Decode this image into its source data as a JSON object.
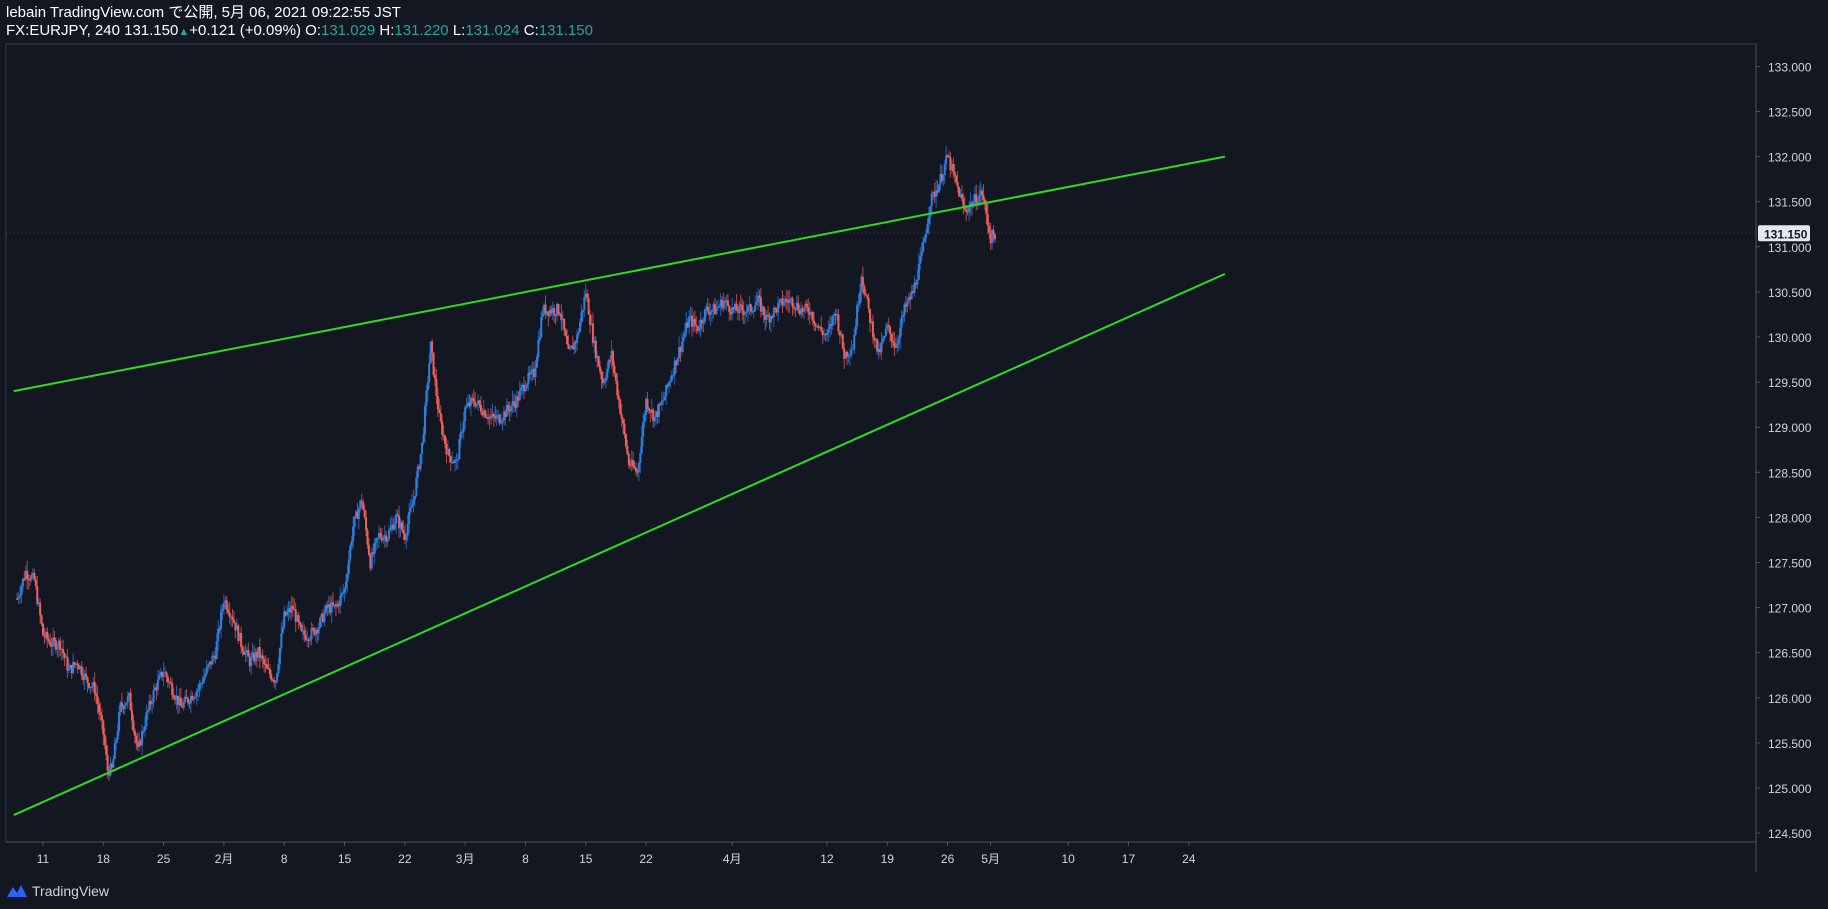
{
  "header": {
    "publisher": "lebain TradingView.com で公開, 5月 06, 2021 09:22:55 JST",
    "symbol_interval": "FX:EURJPY, 240 131.150",
    "change_arrow": "▲",
    "change": "+0.121 (+0.09%)",
    "o_label": "O:",
    "o_value": "131.029",
    "h_label": "H:",
    "h_value": "131.220",
    "l_label": "L:",
    "l_value": "131.024",
    "c_label": "C:",
    "c_value": "131.150"
  },
  "footer": {
    "brand": "TradingView"
  },
  "colors": {
    "background": "#131722",
    "up": "#2f7fe3",
    "down": "#f0605a",
    "trendline": "#2ddc1e",
    "text": "#d1d4dc",
    "price_label_bg": "#e6e8ef"
  },
  "chart_data": {
    "type": "candlestick",
    "symbol": "FX:EURJPY",
    "interval": "240",
    "last_price": 131.15,
    "last_price_label": "131.150",
    "ylim": [
      124.35,
      133.2
    ],
    "y_ticks": [
      "124.500",
      "125.000",
      "125.500",
      "126.000",
      "126.500",
      "127.000",
      "127.500",
      "128.000",
      "128.500",
      "129.000",
      "129.500",
      "130.000",
      "130.500",
      "131.000",
      "131.500",
      "132.000",
      "132.500",
      "133.000"
    ],
    "x_labels": [
      {
        "label": "11",
        "day": 0
      },
      {
        "label": "18",
        "day": 7
      },
      {
        "label": "25",
        "day": 14
      },
      {
        "label": "2月",
        "day": 21
      },
      {
        "label": "8",
        "day": 28
      },
      {
        "label": "15",
        "day": 35
      },
      {
        "label": "22",
        "day": 42
      },
      {
        "label": "3月",
        "day": 49
      },
      {
        "label": "8",
        "day": 56
      },
      {
        "label": "15",
        "day": 63
      },
      {
        "label": "22",
        "day": 70
      },
      {
        "label": "4月",
        "day": 80
      },
      {
        "label": "12",
        "day": 91
      },
      {
        "label": "19",
        "day": 98
      },
      {
        "label": "26",
        "day": 105
      },
      {
        "label": "5月",
        "day": 110
      },
      {
        "label": "10",
        "day": 119
      },
      {
        "label": "17",
        "day": 126
      },
      {
        "label": "24",
        "day": 133
      }
    ],
    "close_path": [
      [
        -3,
        127.1
      ],
      [
        -2,
        127.4
      ],
      [
        -1,
        127.3
      ],
      [
        0,
        126.7
      ],
      [
        1,
        126.6
      ],
      [
        2,
        126.6
      ],
      [
        3,
        126.3
      ],
      [
        4,
        126.4
      ],
      [
        5,
        126.2
      ],
      [
        6,
        126.1
      ],
      [
        7,
        125.6
      ],
      [
        7.5,
        125.2
      ],
      [
        8,
        125.2
      ],
      [
        9,
        125.9
      ],
      [
        10,
        126.0
      ],
      [
        11,
        125.4
      ],
      [
        12,
        125.8
      ],
      [
        13,
        126.1
      ],
      [
        14,
        126.3
      ],
      [
        15,
        126.1
      ],
      [
        16,
        125.9
      ],
      [
        17,
        126.0
      ],
      [
        18,
        126.1
      ],
      [
        19,
        126.3
      ],
      [
        20,
        126.5
      ],
      [
        21,
        127.1
      ],
      [
        22,
        126.9
      ],
      [
        23,
        126.6
      ],
      [
        24,
        126.4
      ],
      [
        25,
        126.5
      ],
      [
        26,
        126.3
      ],
      [
        27,
        126.2
      ],
      [
        28,
        126.9
      ],
      [
        29,
        127.0
      ],
      [
        30,
        126.7
      ],
      [
        31,
        126.7
      ],
      [
        32,
        126.8
      ],
      [
        33,
        127.0
      ],
      [
        34,
        127.0
      ],
      [
        35,
        127.2
      ],
      [
        36,
        127.9
      ],
      [
        37,
        128.2
      ],
      [
        38,
        127.5
      ],
      [
        39,
        127.8
      ],
      [
        40,
        127.8
      ],
      [
        41,
        128.0
      ],
      [
        42,
        127.8
      ],
      [
        43,
        128.2
      ],
      [
        44,
        128.8
      ],
      [
        45,
        129.9
      ],
      [
        46,
        129.1
      ],
      [
        47,
        128.7
      ],
      [
        48,
        128.6
      ],
      [
        49,
        129.2
      ],
      [
        50,
        129.3
      ],
      [
        51,
        129.2
      ],
      [
        52,
        129.1
      ],
      [
        53,
        129.1
      ],
      [
        54,
        129.2
      ],
      [
        55,
        129.3
      ],
      [
        56,
        129.5
      ],
      [
        57,
        129.6
      ],
      [
        58,
        130.3
      ],
      [
        59,
        130.3
      ],
      [
        60,
        130.3
      ],
      [
        61,
        129.8
      ],
      [
        62,
        130.0
      ],
      [
        63,
        130.5
      ],
      [
        64,
        129.9
      ],
      [
        65,
        129.5
      ],
      [
        66,
        129.8
      ],
      [
        67,
        129.2
      ],
      [
        68,
        128.6
      ],
      [
        69,
        128.5
      ],
      [
        70,
        129.3
      ],
      [
        71,
        129.1
      ],
      [
        72,
        129.3
      ],
      [
        73,
        129.6
      ],
      [
        74,
        129.9
      ],
      [
        75,
        130.2
      ],
      [
        76,
        130.1
      ],
      [
        77,
        130.3
      ],
      [
        78,
        130.3
      ],
      [
        79,
        130.4
      ],
      [
        80,
        130.3
      ],
      [
        81,
        130.3
      ],
      [
        82,
        130.3
      ],
      [
        83,
        130.4
      ],
      [
        84,
        130.2
      ],
      [
        85,
        130.3
      ],
      [
        86,
        130.4
      ],
      [
        87,
        130.4
      ],
      [
        88,
        130.3
      ],
      [
        89,
        130.3
      ],
      [
        90,
        130.1
      ],
      [
        91,
        130.0
      ],
      [
        92,
        130.3
      ],
      [
        93,
        129.8
      ],
      [
        94,
        129.9
      ],
      [
        95,
        130.7
      ],
      [
        96,
        130.2
      ],
      [
        97,
        129.8
      ],
      [
        98,
        130.1
      ],
      [
        99,
        129.9
      ],
      [
        100,
        130.3
      ],
      [
        101,
        130.5
      ],
      [
        102,
        130.9
      ],
      [
        103,
        131.5
      ],
      [
        104,
        131.7
      ],
      [
        105,
        132.0
      ],
      [
        106,
        131.7
      ],
      [
        107,
        131.4
      ],
      [
        108,
        131.5
      ],
      [
        109,
        131.6
      ],
      [
        109.6,
        131.3
      ],
      [
        110,
        131.1
      ],
      [
        110.5,
        131.15
      ]
    ],
    "trendlines": [
      {
        "name": "upper",
        "points": [
          [
            -3.4,
            129.4
          ],
          [
            137.2,
            132.0
          ]
        ]
      },
      {
        "name": "lower",
        "points": [
          [
            -3.4,
            124.7
          ],
          [
            137.2,
            130.7
          ]
        ]
      }
    ]
  }
}
